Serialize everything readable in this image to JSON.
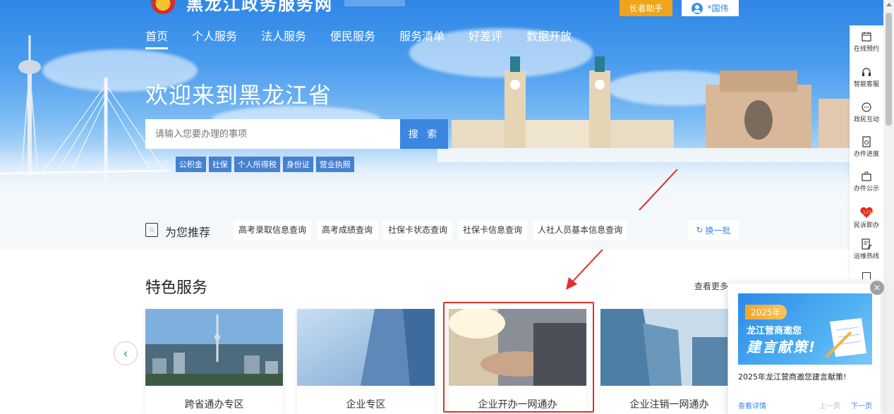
{
  "header": {
    "site_name": "黑龙江政务服务网",
    "elder_button": "长者助手",
    "user_name": "*国伟"
  },
  "nav": {
    "items": [
      "首页",
      "个人服务",
      "法人服务",
      "便民服务",
      "服务清单",
      "好差评",
      "数据开放"
    ],
    "active": "首页"
  },
  "hero": {
    "welcome": "欢迎来到黑龙江省",
    "search_placeholder": "请输入您要办理的事项",
    "search_button": "搜 索",
    "hot_label": "热搜词:",
    "hot_tags": [
      "公积金",
      "社保",
      "个人所得税",
      "身份证",
      "营业执照"
    ]
  },
  "recommend": {
    "title": "为您推荐",
    "items": [
      "高考录取信息查询",
      "高考成绩查询",
      "社保卡状态查询",
      "社保卡信息查询",
      "人社人员基本信息查询"
    ],
    "refresh": "换一批"
  },
  "featured": {
    "title": "特色服务",
    "more": "查看更多",
    "cards": [
      "跨省通办专区",
      "企业专区",
      "企业开办一网通办",
      "企业注销一网通办"
    ]
  },
  "float_bar": {
    "items": [
      "在线预约",
      "智能客服",
      "政民互动",
      "办件进度",
      "办件公示",
      "民诉即办",
      "运维热线"
    ]
  },
  "popup": {
    "banner_year": "2025年",
    "banner_line1": "龙江营商邀您",
    "banner_line2": "建言献策!",
    "text": "2025年龙江营商邀您建言献策!",
    "detail": "查看详情",
    "prev": "上一页",
    "next": "下一页",
    "close": "×"
  },
  "colors": {
    "primary_blue": "#3c86e0",
    "elder_orange": "#f0a419",
    "highlight_red": "#e0302a"
  }
}
